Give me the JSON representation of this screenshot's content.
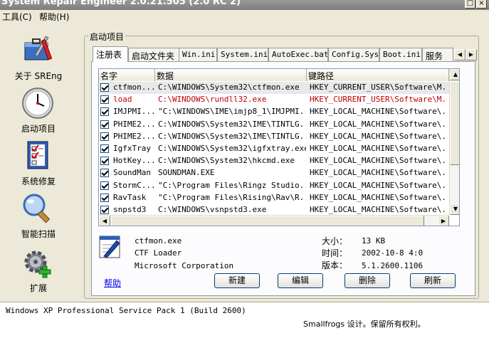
{
  "window": {
    "title": "System Repair Engineer 2.0.21.505 (2.0 RC 2)"
  },
  "menu": [
    {
      "label": "工具(C)"
    },
    {
      "label": "帮助(H)"
    }
  ],
  "sidebar": [
    {
      "label": "关于 SREng",
      "icon": "about-toolbox-icon"
    },
    {
      "label": "启动项目",
      "icon": "clock-icon"
    },
    {
      "label": "系统修复",
      "icon": "checklist-icon"
    },
    {
      "label": "智能扫描",
      "icon": "magnifier-icon"
    },
    {
      "label": "扩展",
      "icon": "gear-plus-icon"
    }
  ],
  "group": {
    "title": "启动项目"
  },
  "tabs": [
    {
      "label": "注册表",
      "active": true
    },
    {
      "label": "启动文件夹",
      "active": false
    },
    {
      "label": "Win.ini",
      "active": false
    },
    {
      "label": "System.ini",
      "active": false
    },
    {
      "label": "AutoExec.bat",
      "active": false
    },
    {
      "label": "Config.Sys",
      "active": false
    },
    {
      "label": "Boot.ini",
      "active": false
    },
    {
      "label": "服务",
      "active": false
    }
  ],
  "list": {
    "columns": [
      "名字",
      "数据",
      "键路径"
    ],
    "rows": [
      {
        "name": "ctfmon...",
        "data": "C:\\WINDOWS\\System32\\ctfmon.exe",
        "path": "HKEY_CURRENT_USER\\Software\\M...",
        "checked": true,
        "selected": true,
        "red": false
      },
      {
        "name": "load",
        "data": "C:\\WINDOWS\\rundll32.exe",
        "path": "HKEY_CURRENT_USER\\Software\\M...",
        "checked": true,
        "selected": false,
        "red": true
      },
      {
        "name": "IMJPMI...",
        "data": "\"C:\\WINDOWS\\IME\\imjp8_1\\IMJPMI...",
        "path": "HKEY_LOCAL_MACHINE\\Software\\...",
        "checked": true,
        "selected": false,
        "red": false
      },
      {
        "name": "PHIME2...",
        "data": "C:\\WINDOWS\\System32\\IME\\TINTLG...",
        "path": "HKEY_LOCAL_MACHINE\\Software\\...",
        "checked": true,
        "selected": false,
        "red": false
      },
      {
        "name": "PHIME2...",
        "data": "C:\\WINDOWS\\System32\\IME\\TINTLG...",
        "path": "HKEY_LOCAL_MACHINE\\Software\\...",
        "checked": true,
        "selected": false,
        "red": false
      },
      {
        "name": "IgfxTray",
        "data": "C:\\WINDOWS\\System32\\igfxtray.exe",
        "path": "HKEY_LOCAL_MACHINE\\Software\\...",
        "checked": true,
        "selected": false,
        "red": false
      },
      {
        "name": "HotKey...",
        "data": "C:\\WINDOWS\\System32\\hkcmd.exe",
        "path": "HKEY_LOCAL_MACHINE\\Software\\...",
        "checked": true,
        "selected": false,
        "red": false
      },
      {
        "name": "SoundMan",
        "data": "SOUNDMAN.EXE",
        "path": "HKEY_LOCAL_MACHINE\\Software\\...",
        "checked": true,
        "selected": false,
        "red": false
      },
      {
        "name": "StormC...",
        "data": "\"C:\\Program Files\\Ringz Studio...",
        "path": "HKEY_LOCAL_MACHINE\\Software\\...",
        "checked": true,
        "selected": false,
        "red": false
      },
      {
        "name": "RavTask",
        "data": "\"C:\\Program Files\\Rising\\Rav\\R...",
        "path": "HKEY_LOCAL_MACHINE\\Software\\...",
        "checked": true,
        "selected": false,
        "red": false
      },
      {
        "name": "snpstd3",
        "data": "C:\\WINDOWS\\vsnpstd3.exe",
        "path": "HKEY_LOCAL_MACHINE\\Software\\...",
        "checked": true,
        "selected": false,
        "red": false
      }
    ]
  },
  "details": {
    "filename": "ctfmon.exe",
    "description": "CTF Loader",
    "company": "Microsoft Corporation",
    "size_label": "大小：",
    "size_value": "13 KB",
    "time_label": "时间：",
    "time_value": "2002-10-8 4:0",
    "version_label": "版本：",
    "version_value": "5.1.2600.1106"
  },
  "actions": {
    "help": "帮助",
    "new": "新建",
    "edit": "编辑",
    "delete": "删除",
    "refresh": "刷新"
  },
  "status": {
    "os": "Windows XP Professional Service Pack 1 (Build 2600)",
    "copyright": "Smallfrogs 设计。保留所有权利。"
  }
}
